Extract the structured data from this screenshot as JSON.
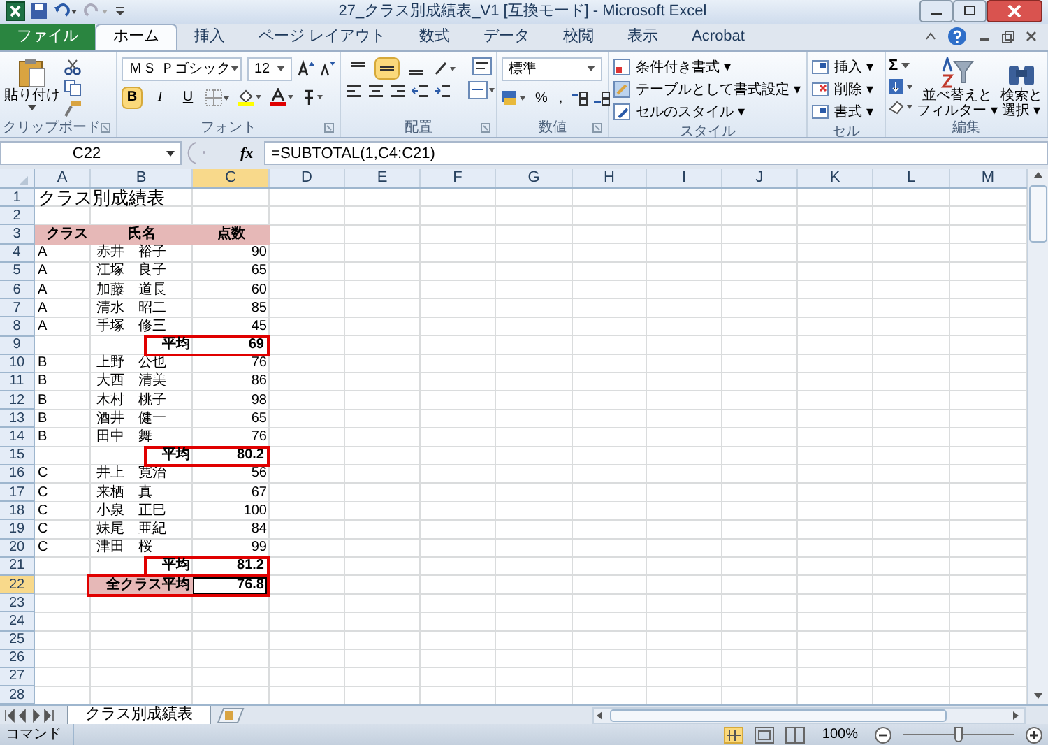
{
  "window": {
    "title": "27_クラス別成績表_V1 [互換モード] - Microsoft Excel"
  },
  "tabs": [
    {
      "label": "ファイル",
      "kind": "file",
      "selected": false
    },
    {
      "label": "ホーム",
      "kind": "tab",
      "selected": true
    },
    {
      "label": "挿入",
      "kind": "tab",
      "selected": false
    },
    {
      "label": "ページ レイアウト",
      "kind": "tab",
      "selected": false
    },
    {
      "label": "数式",
      "kind": "tab",
      "selected": false
    },
    {
      "label": "データ",
      "kind": "tab",
      "selected": false
    },
    {
      "label": "校閲",
      "kind": "tab",
      "selected": false
    },
    {
      "label": "表示",
      "kind": "tab",
      "selected": false
    },
    {
      "label": "Acrobat",
      "kind": "tab",
      "selected": false
    }
  ],
  "ribbon": {
    "paste": "貼り付け",
    "clipboard_label": "クリップボード",
    "font_name": "ＭＳ Ｐゴシック",
    "font_size": "12",
    "font_buttons": [
      {
        "label": "B",
        "selected": true
      },
      {
        "label": "I",
        "selected": false
      },
      {
        "label": "U",
        "selected": false
      }
    ],
    "font_label": "フォント",
    "align_top": [
      {
        "selected": false
      },
      {
        "selected": true
      },
      {
        "selected": false
      }
    ],
    "align_label": "配置",
    "number_format": "標準",
    "number_buttons": [
      "%",
      ","
    ],
    "number_label": "数値",
    "style_items": [
      "条件付き書式 ▾",
      "テーブルとして書式設定 ▾",
      "セルのスタイル ▾"
    ],
    "style_label": "スタイル",
    "cell_items": [
      "挿入 ▾",
      "削除 ▾",
      "書式 ▾"
    ],
    "cell_label": "セル",
    "sum_symbol": "Σ",
    "sort": [
      "並べ替えと",
      "フィルター ▾"
    ],
    "find": [
      "検索と",
      "選択 ▾"
    ],
    "edit_label": "編集"
  },
  "formula_bar": {
    "name_box": "C22",
    "fx": "fx",
    "formula": "=SUBTOTAL(1,C4:C21)"
  },
  "columns": [
    {
      "label": "A",
      "selected": false
    },
    {
      "label": "B",
      "selected": false
    },
    {
      "label": "C",
      "selected": true
    },
    {
      "label": "D",
      "selected": false
    },
    {
      "label": "E",
      "selected": false
    },
    {
      "label": "F",
      "selected": false
    },
    {
      "label": "G",
      "selected": false
    },
    {
      "label": "H",
      "selected": false
    },
    {
      "label": "I",
      "selected": false
    },
    {
      "label": "J",
      "selected": false
    },
    {
      "label": "K",
      "selected": false
    },
    {
      "label": "L",
      "selected": false
    },
    {
      "label": "M",
      "selected": false
    }
  ],
  "rows": [
    {
      "number": "1",
      "selected": false,
      "kind": "title",
      "cells": [
        "クラス別成績表"
      ]
    },
    {
      "number": "2",
      "selected": false,
      "kind": "empty",
      "cells": []
    },
    {
      "number": "3",
      "selected": false,
      "kind": "header",
      "cells": [
        "クラス",
        "氏名",
        "点数"
      ]
    },
    {
      "number": "4",
      "selected": false,
      "kind": "data",
      "cells": [
        "A",
        "赤井　裕子",
        "90"
      ]
    },
    {
      "number": "5",
      "selected": false,
      "kind": "data",
      "cells": [
        "A",
        "江塚　良子",
        "65"
      ]
    },
    {
      "number": "6",
      "selected": false,
      "kind": "data",
      "cells": [
        "A",
        "加藤　道長",
        "60"
      ]
    },
    {
      "number": "7",
      "selected": false,
      "kind": "data",
      "cells": [
        "A",
        "清水　昭二",
        "85"
      ]
    },
    {
      "number": "8",
      "selected": false,
      "kind": "data",
      "cells": [
        "A",
        "手塚　修三",
        "45"
      ]
    },
    {
      "number": "9",
      "selected": false,
      "kind": "subtotal",
      "cells": [
        "",
        "平均",
        "69"
      ]
    },
    {
      "number": "10",
      "selected": false,
      "kind": "data",
      "cells": [
        "B",
        "上野　公也",
        "76"
      ]
    },
    {
      "number": "11",
      "selected": false,
      "kind": "data",
      "cells": [
        "B",
        "大西　清美",
        "86"
      ]
    },
    {
      "number": "12",
      "selected": false,
      "kind": "data",
      "cells": [
        "B",
        "木村　桃子",
        "98"
      ]
    },
    {
      "number": "13",
      "selected": false,
      "kind": "data",
      "cells": [
        "B",
        "酒井　健一",
        "65"
      ]
    },
    {
      "number": "14",
      "selected": false,
      "kind": "data",
      "cells": [
        "B",
        "田中　舞",
        "76"
      ]
    },
    {
      "number": "15",
      "selected": false,
      "kind": "subtotal",
      "cells": [
        "",
        "平均",
        "80.2"
      ]
    },
    {
      "number": "16",
      "selected": false,
      "kind": "data",
      "cells": [
        "C",
        "井上　寛治",
        "56"
      ]
    },
    {
      "number": "17",
      "selected": false,
      "kind": "data",
      "cells": [
        "C",
        "来栖　真",
        "67"
      ]
    },
    {
      "number": "18",
      "selected": false,
      "kind": "data",
      "cells": [
        "C",
        "小泉　正巳",
        "100"
      ]
    },
    {
      "number": "19",
      "selected": false,
      "kind": "data",
      "cells": [
        "C",
        "妹尾　亜紀",
        "84"
      ]
    },
    {
      "number": "20",
      "selected": false,
      "kind": "data",
      "cells": [
        "C",
        "津田　桜",
        "99"
      ]
    },
    {
      "number": "21",
      "selected": false,
      "kind": "subtotal",
      "cells": [
        "",
        "平均",
        "81.2"
      ]
    },
    {
      "number": "22",
      "selected": true,
      "kind": "total",
      "cells": [
        "",
        "全クラス平均",
        "76.8"
      ]
    },
    {
      "number": "23",
      "selected": false,
      "kind": "empty",
      "cells": []
    },
    {
      "number": "24",
      "selected": false,
      "kind": "empty",
      "cells": []
    },
    {
      "number": "25",
      "selected": false,
      "kind": "empty",
      "cells": []
    },
    {
      "number": "26",
      "selected": false,
      "kind": "empty",
      "cells": []
    },
    {
      "number": "27",
      "selected": false,
      "kind": "empty",
      "cells": []
    },
    {
      "number": "28",
      "selected": false,
      "kind": "empty",
      "cells": []
    }
  ],
  "sheet_tabs": [
    {
      "label": "クラス別成績表",
      "selected": true
    }
  ],
  "status_bar": {
    "mode": "コマンド",
    "zoom": "100%",
    "zoom_slider": {
      "level": 0.5
    }
  }
}
